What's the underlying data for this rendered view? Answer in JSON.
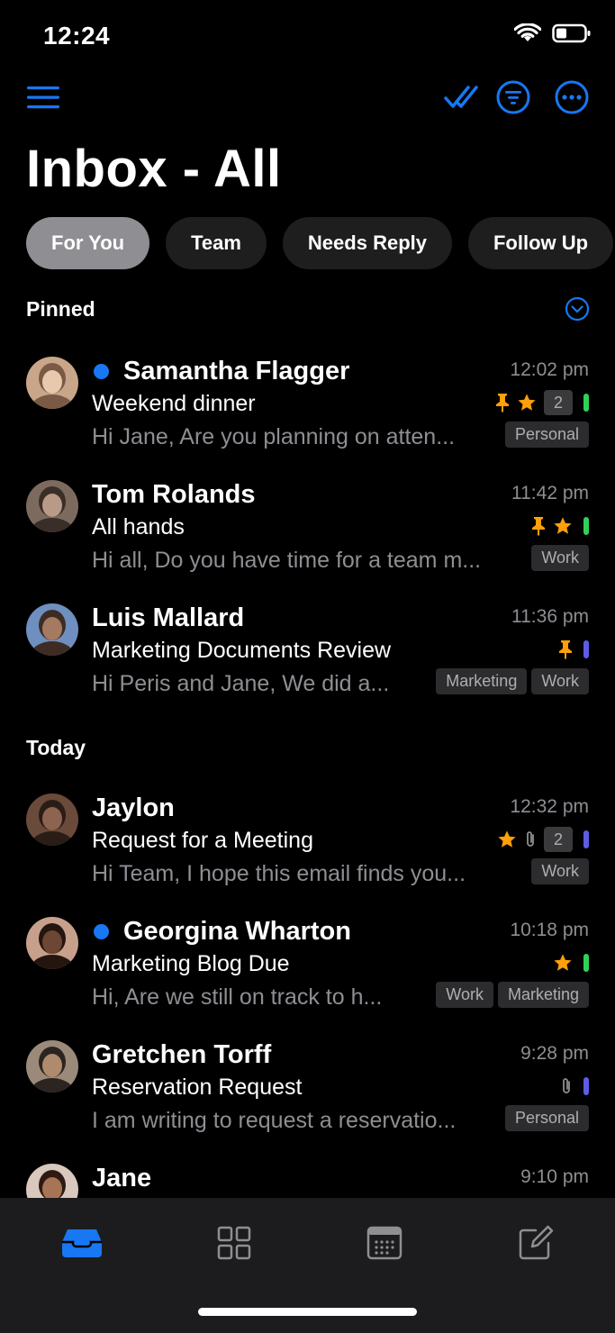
{
  "status": {
    "time": "12:24"
  },
  "header": {
    "title": "Inbox - All"
  },
  "filters": [
    "For You",
    "Team",
    "Needs Reply",
    "Follow Up"
  ],
  "sections": {
    "pinned": "Pinned",
    "today": "Today"
  },
  "colors": {
    "accent": "#1877f2",
    "star": "#ff9f0a",
    "green": "#30d158",
    "purple": "#5e5ce6",
    "muted": "#8e8e93"
  },
  "mails": [
    {
      "sender": "Samantha Flagger",
      "unread": true,
      "time": "12:02 pm",
      "subject": "Weekend dinner",
      "preview": "Hi Jane, Are you planning on atten...",
      "pinned": true,
      "starred": true,
      "attachment": false,
      "count": "2",
      "bar": "green",
      "tags": [
        "Personal"
      ]
    },
    {
      "sender": "Tom Rolands",
      "unread": false,
      "time": "11:42 pm",
      "subject": "All hands",
      "preview": "Hi all, Do you have time for a team m...",
      "pinned": true,
      "starred": true,
      "attachment": false,
      "count": "",
      "bar": "green",
      "tags": [
        "Work"
      ]
    },
    {
      "sender": "Luis Mallard",
      "unread": false,
      "time": "11:36 pm",
      "subject": "Marketing Documents Review",
      "preview": "Hi Peris and Jane, We did a...",
      "pinned": true,
      "starred": false,
      "attachment": false,
      "count": "",
      "bar": "purple",
      "tags": [
        "Marketing",
        "Work"
      ]
    },
    {
      "sender": "Jaylon",
      "unread": false,
      "time": "12:32 pm",
      "subject": "Request for a Meeting",
      "preview": "Hi Team, I hope this email finds you...",
      "pinned": false,
      "starred": true,
      "attachment": true,
      "count": "2",
      "bar": "purple",
      "tags": [
        "Work"
      ]
    },
    {
      "sender": "Georgina Wharton",
      "unread": true,
      "time": "10:18 pm",
      "subject": "Marketing Blog Due",
      "preview": "Hi, Are we still on track to h...",
      "pinned": false,
      "starred": true,
      "attachment": false,
      "count": "",
      "bar": "green",
      "tags": [
        "Work",
        "Marketing"
      ]
    },
    {
      "sender": "Gretchen Torff",
      "unread": false,
      "time": "9:28 pm",
      "subject": "Reservation Request",
      "preview": "I am writing to request a reservatio...",
      "pinned": false,
      "starred": false,
      "attachment": true,
      "count": "",
      "bar": "purple",
      "tags": [
        "Personal"
      ]
    },
    {
      "sender": "Jane",
      "unread": false,
      "time": "9:10 pm",
      "subject": "",
      "preview": "",
      "pinned": false,
      "starred": false,
      "attachment": false,
      "count": "",
      "bar": "",
      "tags": []
    }
  ],
  "tabbar": {
    "items": [
      "inbox-icon",
      "apps-grid-icon",
      "calendar-icon",
      "compose-icon"
    ],
    "active": "inbox-icon"
  }
}
